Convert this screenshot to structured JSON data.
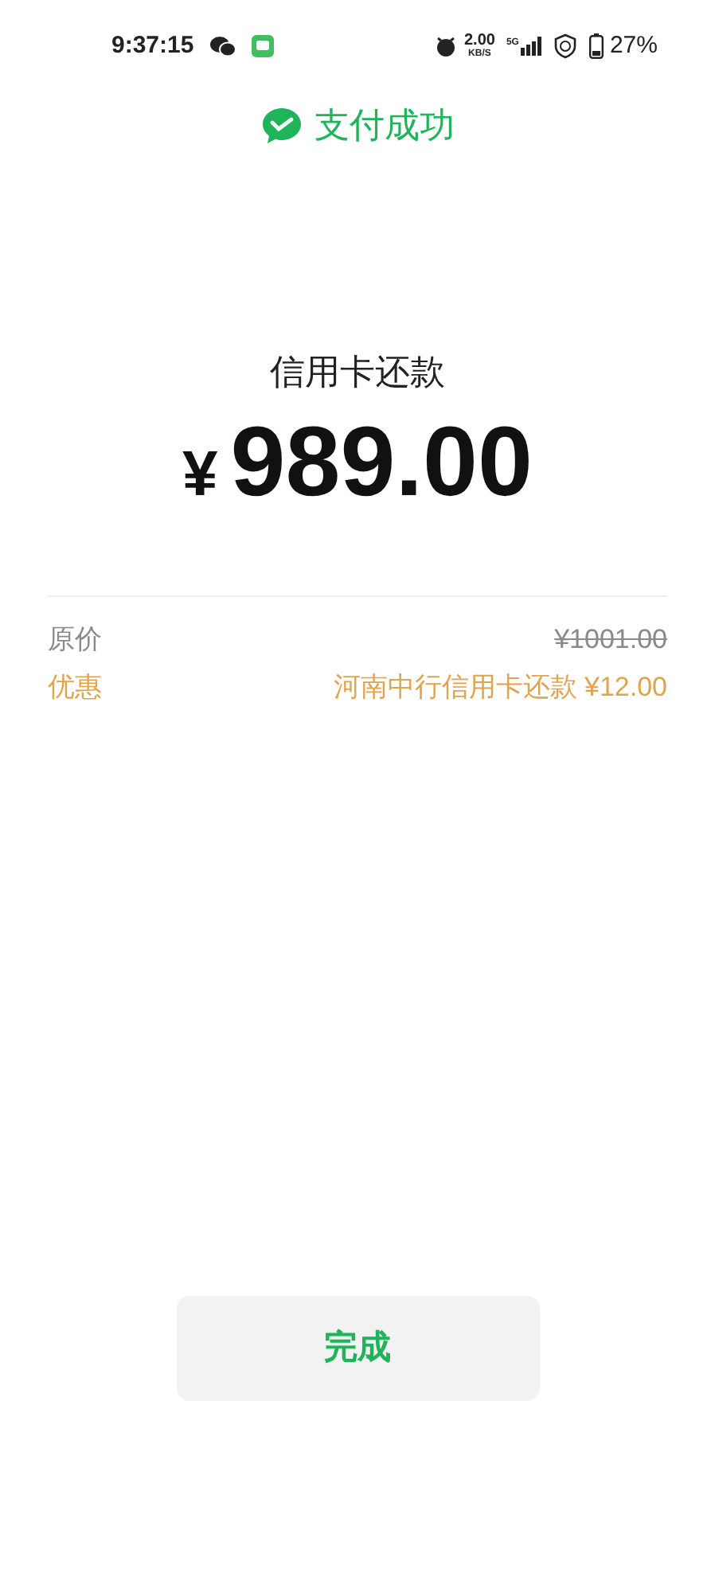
{
  "status_bar": {
    "time": "9:37:15",
    "speed": "2.00",
    "speed_unit": "KB/S",
    "network": "5G",
    "battery": "27%"
  },
  "header": {
    "title": "支付成功"
  },
  "payment": {
    "label": "信用卡还款",
    "currency": "¥",
    "amount": "989.00"
  },
  "details": [
    {
      "kind": "original",
      "label": "原价",
      "value": "¥1001.00"
    },
    {
      "kind": "discount",
      "label": "优惠",
      "value": "河南中行信用卡还款 ¥12.00"
    }
  ],
  "done_button": {
    "label": "完成"
  }
}
